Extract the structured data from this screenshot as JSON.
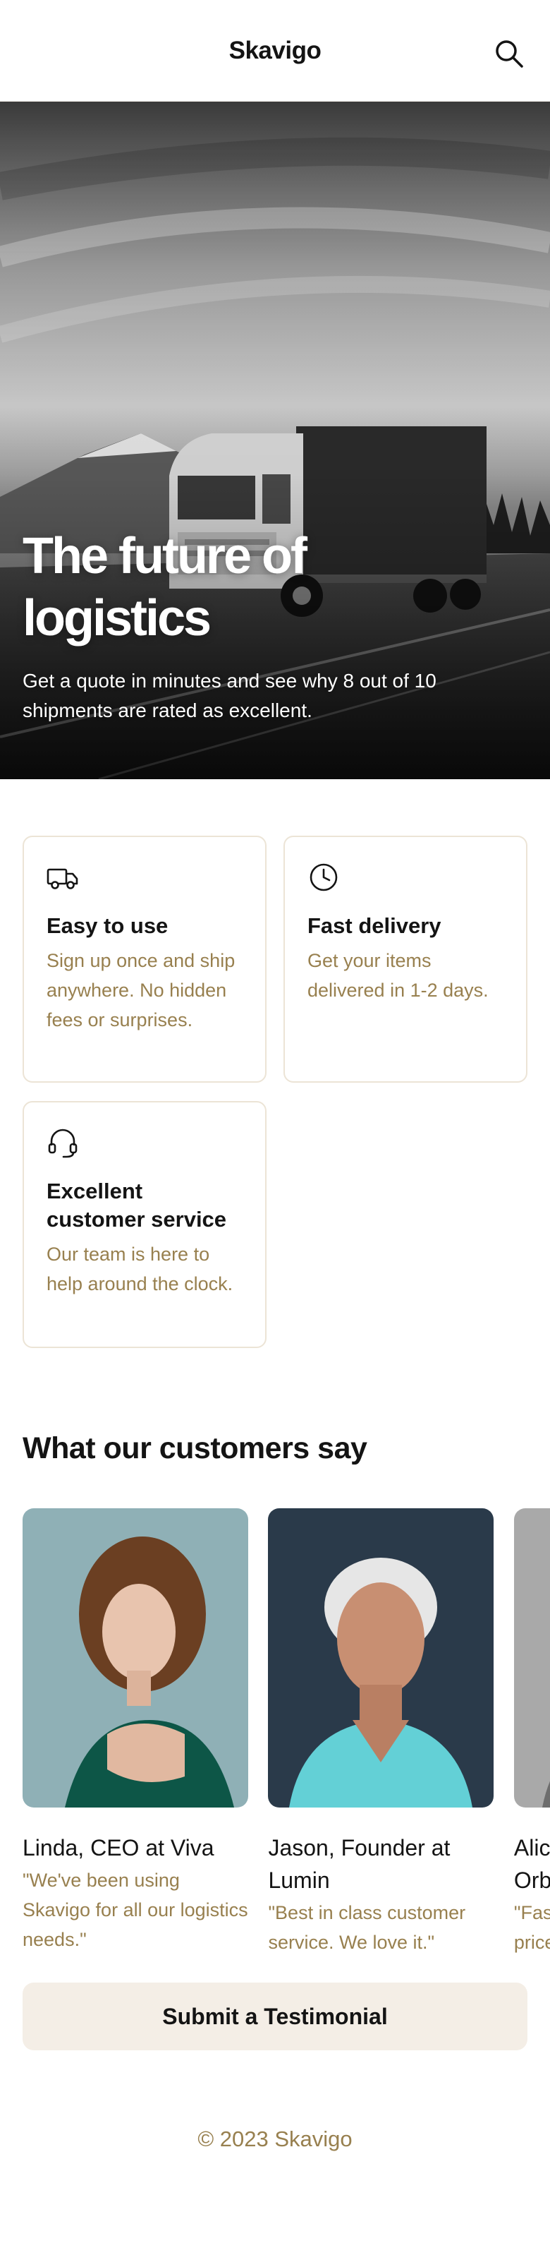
{
  "header": {
    "brand": "Skavigo",
    "search_icon": "search-icon"
  },
  "hero": {
    "title_line1": "The future of",
    "title_line2": "logistics",
    "subtitle": "Get a quote in minutes and see why 8 out of 10 shipments are rated as excellent."
  },
  "features": [
    {
      "icon": "truck-icon",
      "title": "Easy to use",
      "text": "Sign up once and ship anywhere. No hidden fees or surprises."
    },
    {
      "icon": "clock-icon",
      "title": "Fast delivery",
      "text": "Get your items delivered in 1-2 days."
    },
    {
      "icon": "headset-icon",
      "title": "Excellent customer service",
      "text": "Our team is here to help around the clock."
    }
  ],
  "testimonials": {
    "heading": "What our customers say",
    "items": [
      {
        "name": "Linda, CEO at Viva",
        "quote": "\"We've been using Skavigo for all our logistics needs.\""
      },
      {
        "name": "Jason, Founder at Lumin",
        "quote": "\"Best in class customer service. We love it.\""
      },
      {
        "name": "Alice, Manager at Orbit",
        "quote": "\"Fast, reliable and the prices are great. Highly recommend.\""
      }
    ],
    "submit_label": "Submit a Testimonial"
  },
  "footer": {
    "copyright": "© 2023 Skavigo"
  },
  "colors": {
    "accent_text": "#98804f",
    "card_border": "#ece4d6",
    "button_bg": "#f4eee6"
  }
}
